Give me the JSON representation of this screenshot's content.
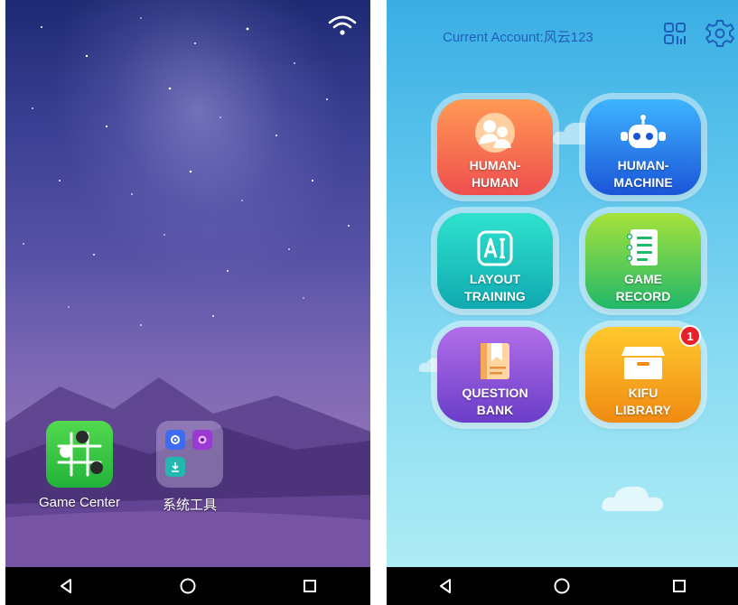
{
  "left_screen": {
    "apps": [
      {
        "label": "Game Center",
        "icon": "go-board-icon"
      },
      {
        "label": "系统工具",
        "icon": "folder-icon"
      }
    ],
    "status": {
      "icon": "wifi-icon"
    },
    "nav": [
      "back-icon",
      "home-icon",
      "recents-icon"
    ]
  },
  "right_screen": {
    "account_text": "Current Account:风云123",
    "header_icons": [
      "qr-code-icon",
      "gear-icon"
    ],
    "menu": [
      {
        "label": "HUMAN-\nHUMAN",
        "icon": "people-icon",
        "color": "#f04e4e"
      },
      {
        "label": "HUMAN-\nMACHINE",
        "icon": "robot-icon",
        "color": "#1a55d8"
      },
      {
        "label": "LAYOUT\nTRAINING",
        "icon": "ai-icon",
        "color": "#10a9b0"
      },
      {
        "label": "GAME\nRECORD",
        "icon": "notebook-icon",
        "color": "#22b86a"
      },
      {
        "label": "QUESTION\nBANK",
        "icon": "book-icon",
        "color": "#6a3dc9"
      },
      {
        "label": "KIFU\nLIBRARY",
        "icon": "box-icon",
        "color": "#f08a12"
      }
    ],
    "kifu_badge_count": "1",
    "nav": [
      "back-icon",
      "home-icon",
      "recents-icon"
    ]
  }
}
